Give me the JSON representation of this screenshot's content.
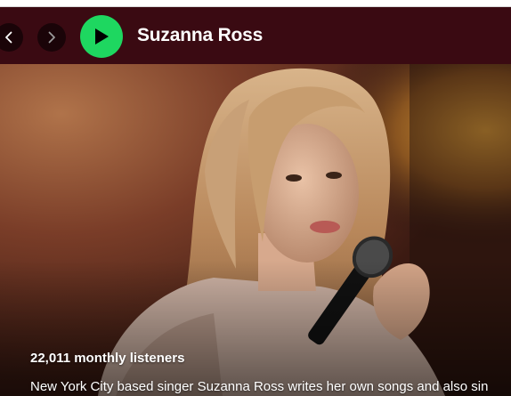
{
  "header": {
    "artist_name": "Suzanna Ross",
    "background_color": "#3a0a12",
    "play_button_color": "#1ed760",
    "back_icon": "chevron-left-icon",
    "forward_icon": "chevron-right-icon",
    "play_icon": "play-icon"
  },
  "hero": {
    "monthly_listeners": "22,011 monthly listeners",
    "bio": "New York City based singer Suzanna Ross writes her own songs and also sin"
  }
}
